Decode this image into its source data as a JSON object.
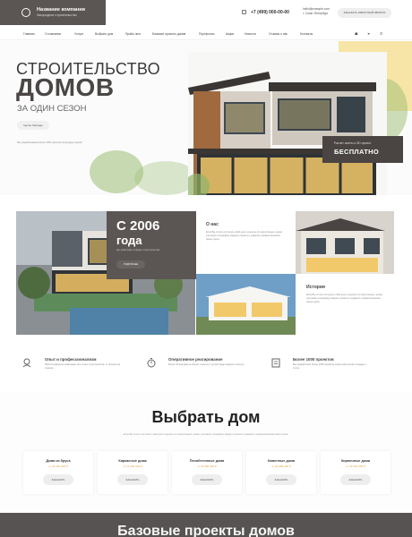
{
  "header": {
    "company_name": "Название компании",
    "company_sub": "Загородное строительство",
    "phone": "+7 (499) 000-00-00",
    "email_line1": "hello@example.com",
    "email_line2": "г. Санкт-Петербург",
    "call_button": "ЗАКАЗАТЬ ОБРАТНЫЙ ЗВОНОК"
  },
  "nav": {
    "items": [
      "Главная",
      "О компании",
      "Услуги",
      "Выбрать дом",
      "Прайс-лист",
      "Базовые проекты домов",
      "Портфолио",
      "Акции",
      "Новости",
      "Отзывы о нас",
      "Контакты"
    ],
    "icons": [
      "vk-icon",
      "telegram-icon",
      "whatsapp-icon"
    ]
  },
  "hero": {
    "title_line1": "СТРОИТЕЛЬСТВО",
    "title_line2": "ДОМОВ",
    "title_line3": "ЗА ОДИН СЕЗОН",
    "button": "Целое бригады",
    "note": "Мы разрабатываем более 1000 проектов загородных домов",
    "badge_line1": "Расчет сметы и 3D-проект",
    "badge_line2": "БЕСПЛАТНО"
  },
  "about": {
    "year_big": "С 2006",
    "year_small": "года",
    "year_sub": "мы работаем в сфере строительства",
    "year_button": "ПОДРОБНЕЕ",
    "about_title": "О нас",
    "about_text": "Если Вы хотите построить свой дом и сделать это качественно, нужно учитывать специфику каждого проекта и доверять профессионалам своего дела.",
    "history_title": "История",
    "history_text": "Если Вы хотите построить свой дом и сделать это качественно, нужно учитывать специфику каждого проекта и доверять профессионалам своего дела."
  },
  "features": [
    {
      "title": "Опыт и профессионализм",
      "text": "Работа компании охватывает все этапы строительства, от проекта до отделки",
      "icon": "worker-icon"
    },
    {
      "title": "Оперативное реагирование",
      "text": "Более 15 выездов на объект в месяц с учетом задач каждого клиента",
      "icon": "stopwatch-icon"
    },
    {
      "title": "Более 1000 проектов",
      "text": "Мы разработали более 1000 проектов домов различной площади и стиля",
      "icon": "blueprint-icon"
    }
  ],
  "choose": {
    "title": "Выбрать дом",
    "subtitle": "Если Вы хотите построить свой дом и сделать это качественно, нужно учитывать специфику каждого проекта и доверять профессионалам своего дела.",
    "cards": [
      {
        "name": "Дома из бруса",
        "price": "от 25 000 000 ₽",
        "button": "ЗАКАЗАТЬ"
      },
      {
        "name": "Каркасные дома",
        "price": "от 12 000 000 ₽",
        "button": "ЗАКАЗАТЬ"
      },
      {
        "name": "Пенобетонные дома",
        "price": "от 15 000 000 ₽",
        "button": "ЗАКАЗАТЬ"
      },
      {
        "name": "Каменные дома",
        "price": "от 20 000 000 ₽",
        "button": "ЗАКАЗАТЬ"
      },
      {
        "name": "Кирпичные дома",
        "price": "от 18 000 000 ₽",
        "button": "ЗАКАЗАТЬ"
      }
    ]
  },
  "band": {
    "title": "Базовые проекты домов"
  },
  "colors": {
    "brand_dark": "#5b5654",
    "accent_yellow": "#f6e5a6",
    "price_orange": "#e8a24b"
  }
}
